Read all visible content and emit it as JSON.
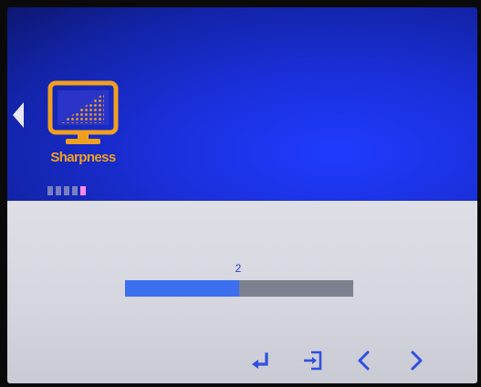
{
  "menu": {
    "label": "Sharpness",
    "icon": "sharpness-icon",
    "page_indicator": {
      "total": 5,
      "active_index": 4
    }
  },
  "slider": {
    "value": "2",
    "fill_percent": 50
  },
  "buttons": {
    "enter": "enter-icon",
    "exit": "exit-icon",
    "left": "chevron-left-icon",
    "right": "chevron-right-icon"
  },
  "colors": {
    "accent_orange": "#f0a020",
    "panel_blue": "#1a2fd8",
    "slider_fill": "#3c6ff0",
    "slider_track": "#7c808f",
    "active_dot": "#ff8ae6",
    "button_blue": "#2f4fe0"
  }
}
